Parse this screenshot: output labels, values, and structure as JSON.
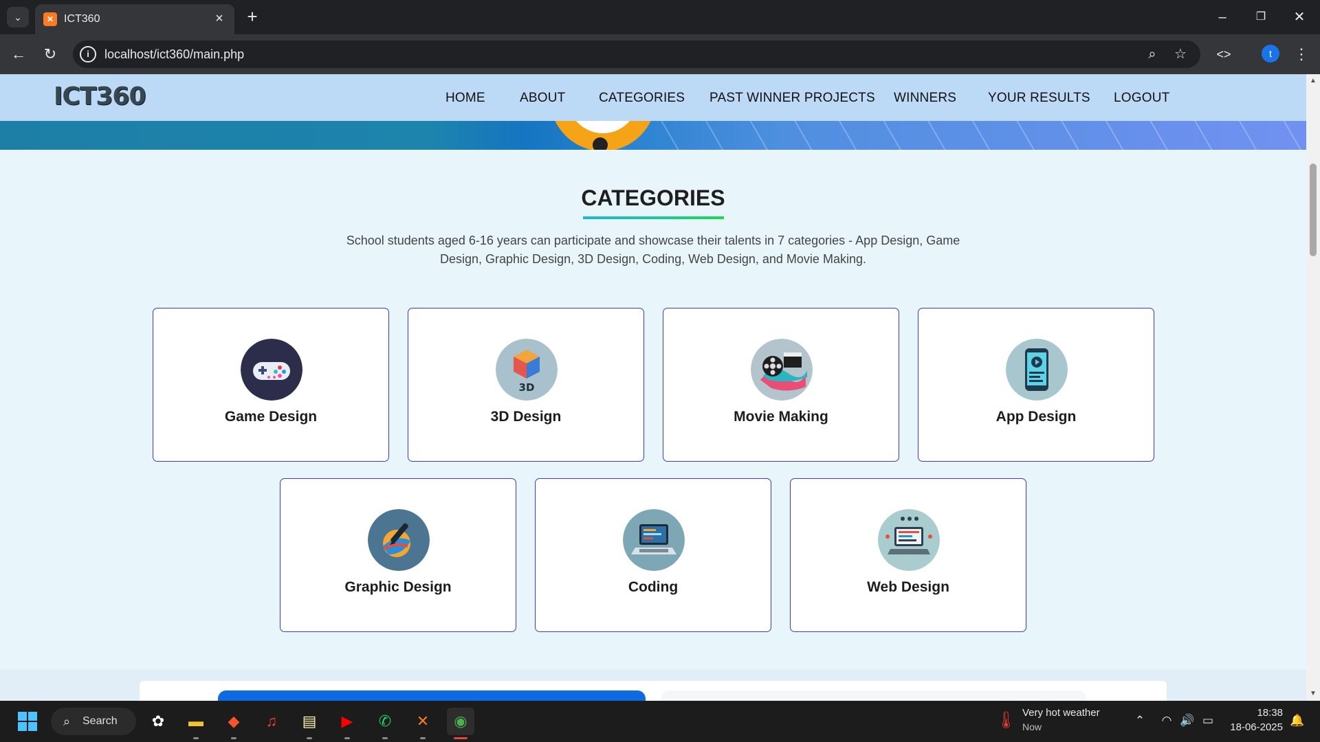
{
  "browser": {
    "tab_title": "ICT360",
    "url": "localhost/ict360/main.php",
    "profile_initial": "t"
  },
  "site": {
    "logo_text": "ICT360",
    "nav": [
      {
        "label": "HOME"
      },
      {
        "label": "ABOUT"
      },
      {
        "label": "CATEGORIES"
      },
      {
        "label": "PAST WINNER PROJECTS"
      },
      {
        "label": "WINNERS"
      },
      {
        "label": "YOUR RESULTS"
      },
      {
        "label": "LOGOUT"
      }
    ]
  },
  "categories": {
    "title": "CATEGORIES",
    "description": "School students aged 6-16 years can participate and showcase their talents in 7 categories - App Design, Game Design, Graphic Design, 3D Design, Coding, Web Design, and Movie Making.",
    "items": [
      {
        "label": "Game Design",
        "icon": "gamepad-icon"
      },
      {
        "label": "3D Design",
        "icon": "cube-3d-icon"
      },
      {
        "label": "Movie Making",
        "icon": "film-reel-icon"
      },
      {
        "label": "App Design",
        "icon": "mobile-app-icon"
      },
      {
        "label": "Graphic Design",
        "icon": "pen-brush-icon"
      },
      {
        "label": "Coding",
        "icon": "laptop-code-icon"
      },
      {
        "label": "Web Design",
        "icon": "web-laptop-icon"
      }
    ]
  },
  "taskbar": {
    "search_label": "Search",
    "weather_main": "Very hot weather",
    "weather_sub": "Now",
    "time": "18:38",
    "date": "18-06-2025"
  },
  "colors": {
    "accent_border": "#3a3ad0",
    "page_bg": "#e8f6fc",
    "nav_bg": "#bcd9f5"
  }
}
